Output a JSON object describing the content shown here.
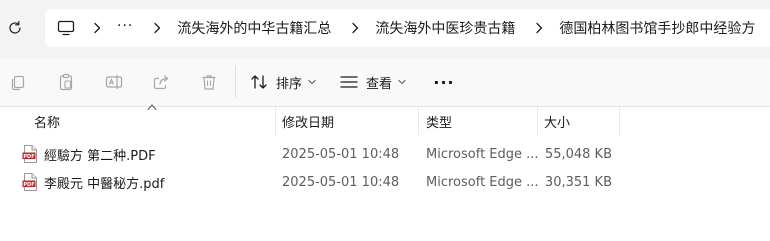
{
  "breadcrumb": {
    "overflow": "···",
    "items": [
      "流失海外的中华古籍汇总",
      "流失海外中医珍贵古籍",
      "德国柏林图书馆手抄郎中经验方"
    ]
  },
  "toolbar": {
    "icons": [
      "copy-icon",
      "paste-icon",
      "rename-icon",
      "share-icon",
      "delete-icon"
    ],
    "sort_label": "排序",
    "view_label": "查看",
    "more_label": "···"
  },
  "list": {
    "columns": {
      "name": "名称",
      "modified": "修改日期",
      "type": "类型",
      "size": "大小"
    },
    "rows": [
      {
        "name": "經驗方 第二种.PDF",
        "modified": "2025-05-01 10:48",
        "type": "Microsoft Edge ...",
        "size": "55,048 KB"
      },
      {
        "name": "李殿元 中醫秘方.pdf",
        "modified": "2025-05-01 10:48",
        "type": "Microsoft Edge ...",
        "size": "30,351 KB"
      }
    ]
  },
  "colors": {
    "accent": "#0067c0",
    "pdf_red": "#c4262e",
    "disabled_icon": "#a8a8a8"
  }
}
